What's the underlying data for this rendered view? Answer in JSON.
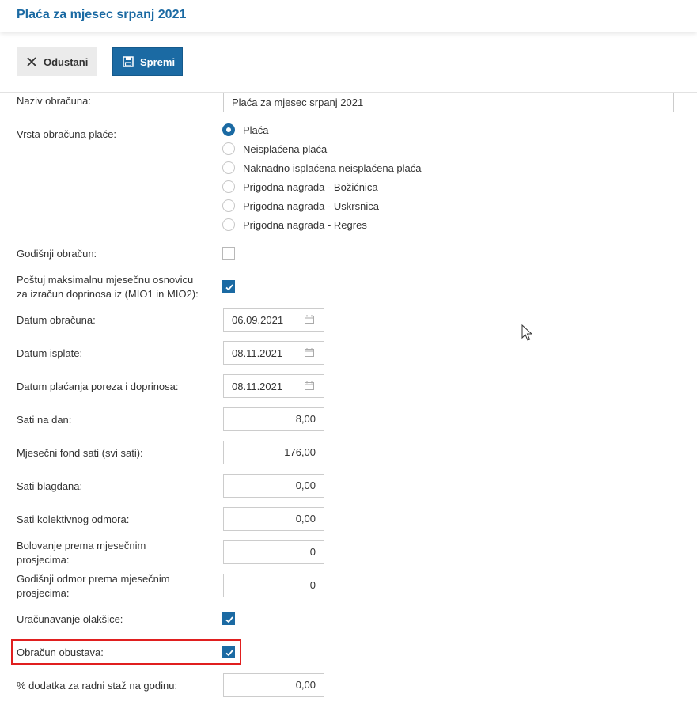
{
  "header": {
    "title": "Plaća za mjesec srpanj 2021"
  },
  "toolbar": {
    "cancel_label": "Odustani",
    "save_label": "Spremi"
  },
  "form": {
    "naziv": {
      "label": "Naziv obračuna:",
      "value": "Plaća za mjesec srpanj 2021"
    },
    "vrsta": {
      "label": "Vrsta obračuna plaće:",
      "options": [
        "Plaća",
        "Neisplaćena plaća",
        "Naknadno isplaćena neisplaćena plaća",
        "Prigodna nagrada - Božićnica",
        "Prigodna nagrada - Uskrsnica",
        "Prigodna nagrada - Regres"
      ],
      "selected": "Plaća"
    },
    "godisnji": {
      "label": "Godišnji obračun:",
      "checked": false
    },
    "postuj": {
      "label_line1": "Poštuj maksimalnu mjesečnu osnovicu",
      "label_line2": "za izračun doprinosa iz (MIO1 in MIO2):",
      "checked": true
    },
    "datum_obracuna": {
      "label": "Datum obračuna:",
      "value": "06.09.2021"
    },
    "datum_isplate": {
      "label": "Datum isplate:",
      "value": "08.11.2021"
    },
    "datum_placanja": {
      "label": "Datum plaćanja poreza i doprinosa:",
      "value": "08.11.2021"
    },
    "sati_na_dan": {
      "label": "Sati na dan:",
      "value": "8,00"
    },
    "mjesecni_fond": {
      "label": "Mjesečni fond sati (svi sati):",
      "value": "176,00"
    },
    "sati_blagdana": {
      "label": "Sati blagdana:",
      "value": "0,00"
    },
    "sati_kolektivnog": {
      "label": "Sati kolektivnog odmora:",
      "value": "0,00"
    },
    "bolovanje": {
      "label_line1": "Bolovanje prema mjesečnim",
      "label_line2": "prosjecima:",
      "value": "0"
    },
    "godisnji_odmor": {
      "label_line1": "Godišnji odmor prema mjesečnim",
      "label_line2": "prosjecima:",
      "value": "0"
    },
    "olaksice": {
      "label": "Uračunavanje olakšice:",
      "checked": true
    },
    "obustave": {
      "label": "Obračun obustava:",
      "checked": true
    },
    "dodatak": {
      "label": "% dodatka za radni staž na godinu:",
      "value": "0,00"
    }
  },
  "colors": {
    "accent": "#1b6aa3",
    "highlight": "#e01f1f"
  }
}
